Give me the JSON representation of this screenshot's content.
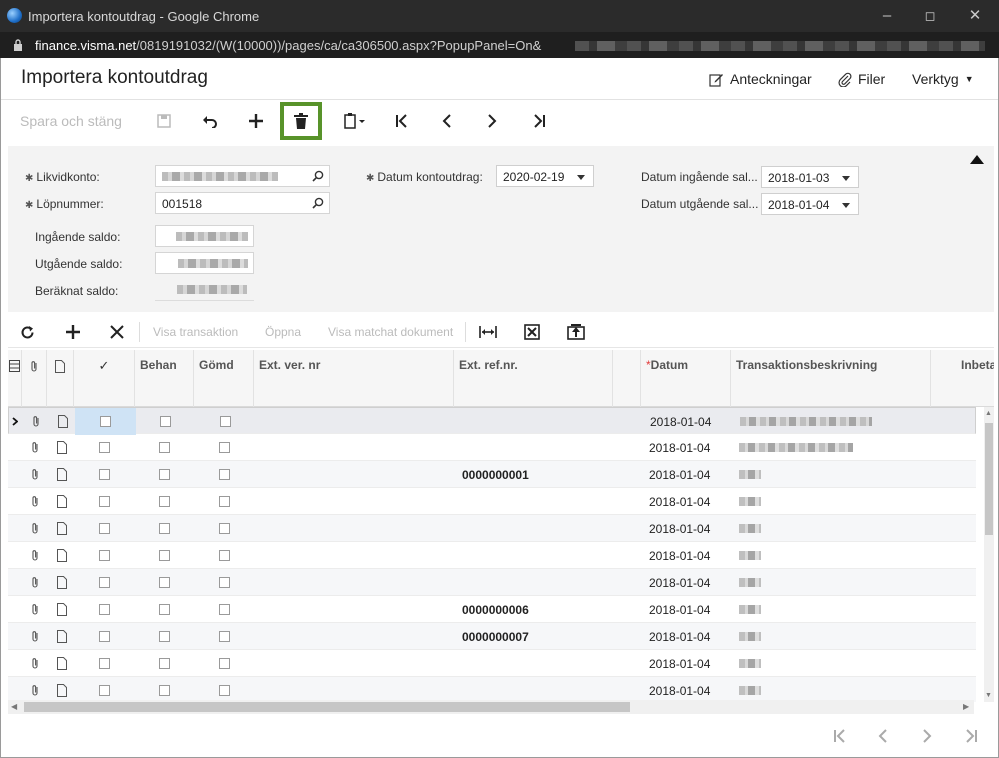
{
  "window": {
    "title": "Importera kontoutdrag - Google Chrome",
    "url_host": "finance.visma.net",
    "url_path": "/0819191032/(W(10000))/pages/ca/ca306500.aspx?PopupPanel=On&"
  },
  "header": {
    "title": "Importera kontoutdrag",
    "notes": "Anteckningar",
    "files": "Filer",
    "tools": "Verktyg"
  },
  "toolbar": {
    "save_close": "Spara och stäng"
  },
  "form": {
    "likvidkonto_label": "Likvidkonto:",
    "lopnummer_label": "Löpnummer:",
    "lopnummer_value": "001518",
    "ingaende_saldo_label": "Ingående saldo:",
    "utgaende_saldo_label": "Utgående saldo:",
    "beraknat_saldo_label": "Beräknat saldo:",
    "datum_kontoutdrag_label": "Datum kontoutdrag:",
    "datum_kontoutdrag_value": "2020-02-19",
    "datum_ingaende_label": "Datum ingående sal...",
    "datum_ingaende_value": "2018-01-03",
    "datum_utgaende_label": "Datum utgående sal...",
    "datum_utgaende_value": "2018-01-04"
  },
  "grid_toolbar": {
    "visa_transaktion": "Visa transaktion",
    "oppna": "Öppna",
    "visa_matchat": "Visa matchat dokument"
  },
  "grid": {
    "columns": {
      "check": "✓",
      "behan": "Behan",
      "gomd": "Gömd",
      "ext_ver_nr": "Ext. ver. nr",
      "ext_ref_nr": "Ext. ref.nr.",
      "datum": "Datum",
      "transaktionsbeskrivning": "Transaktionsbeskrivning",
      "inbetalning": "Inbeta"
    },
    "rows": [
      {
        "ref": "",
        "date": "2018-01-04"
      },
      {
        "ref": "",
        "date": "2018-01-04"
      },
      {
        "ref": "0000000001",
        "date": "2018-01-04"
      },
      {
        "ref": "",
        "date": "2018-01-04"
      },
      {
        "ref": "",
        "date": "2018-01-04"
      },
      {
        "ref": "",
        "date": "2018-01-04"
      },
      {
        "ref": "",
        "date": "2018-01-04"
      },
      {
        "ref": "0000000006",
        "date": "2018-01-04"
      },
      {
        "ref": "0000000007",
        "date": "2018-01-04"
      },
      {
        "ref": "",
        "date": "2018-01-04"
      },
      {
        "ref": "",
        "date": "2018-01-04"
      }
    ]
  },
  "colors": {
    "highlight_border": "#58932a",
    "required_star": "#e23b3b"
  }
}
